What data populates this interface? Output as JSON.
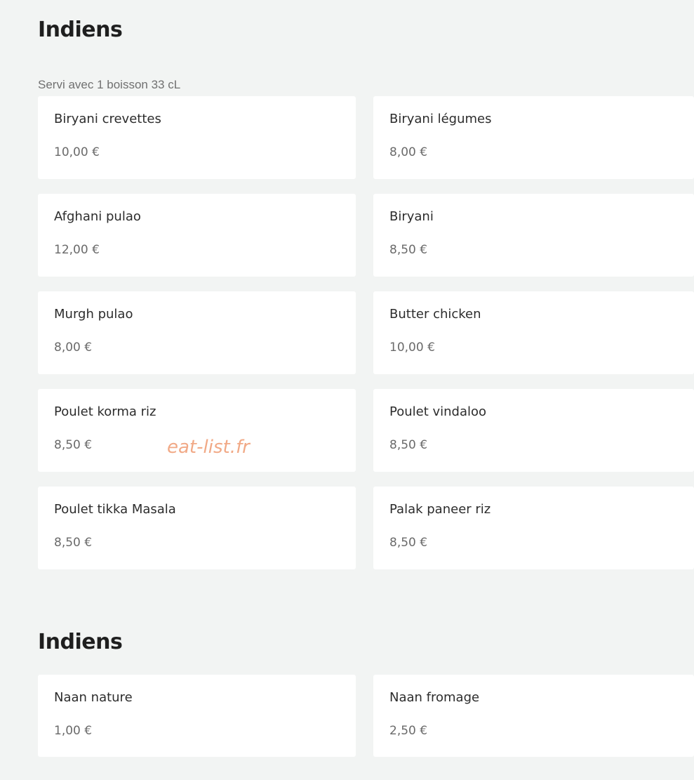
{
  "sections": [
    {
      "title": "Indiens",
      "subtitle": "Servi avec 1 boisson 33 cL",
      "items": [
        {
          "name": "Biryani crevettes",
          "price": "10,00 €"
        },
        {
          "name": "Biryani légumes",
          "price": "8,00 €"
        },
        {
          "name": "Afghani pulao",
          "price": "12,00 €"
        },
        {
          "name": "Biryani",
          "price": "8,50 €"
        },
        {
          "name": "Murgh pulao",
          "price": "8,00 €"
        },
        {
          "name": "Butter chicken",
          "price": "10,00 €"
        },
        {
          "name": "Poulet korma riz",
          "price": "8,50 €"
        },
        {
          "name": "Poulet vindaloo",
          "price": "8,50 €"
        },
        {
          "name": "Poulet tikka Masala",
          "price": "8,50 €"
        },
        {
          "name": "Palak paneer riz",
          "price": "8,50 €"
        }
      ]
    },
    {
      "title": "Indiens",
      "items": [
        {
          "name": "Naan nature",
          "price": "1,00 €"
        },
        {
          "name": "Naan fromage",
          "price": "2,50 €"
        }
      ]
    }
  ],
  "watermark": "eat-list.fr"
}
